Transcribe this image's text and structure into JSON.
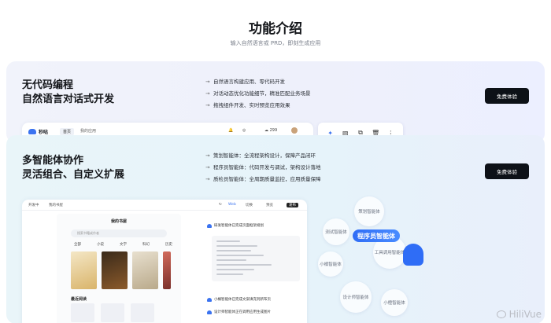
{
  "header": {
    "title": "功能介绍",
    "subtitle": "输入自然语言或 PRD，即刻生成应用"
  },
  "feature1": {
    "title_line1": "无代码编程",
    "title_line2": "自然语言对话式开发",
    "bullets": [
      "自然语言构建应用、零代码开发",
      "对话动态优化功能细节，精准匹配业务场景",
      "拖拽组件开发、实时预览应用效果"
    ],
    "cta": "免费体验",
    "preview": {
      "logo": "秒哒",
      "tab_home": "首页",
      "tab_apps": "我的应用",
      "credits": "299"
    }
  },
  "feature2": {
    "title_line1": "多智能体协作",
    "title_line2": "灵活组合、自定义扩展",
    "bullets": [
      "策划智能体：全流程架构设计，保障产品闭环",
      "程序员智能体：代码开发与调试，架构设计落地",
      "质检员智能体：全周期质量监控，应用质量保障"
    ],
    "cta": "免费体验",
    "app": {
      "tab1": "开发中",
      "tab2": "我的书屋",
      "badge1": "Web",
      "badge2": "切换",
      "preview": "预览",
      "publish": "发布",
      "phone_title": "我的书屋",
      "search_placeholder": "搜索书籍或作者",
      "categories": [
        "全部",
        "小说",
        "文学",
        "科幻",
        "历史"
      ],
      "recent": "最近阅读",
      "msg1": "研发智能体已完成页面框架规划",
      "msg2": "小橘智能体已完成文案填充到新布页",
      "msg3": "设计师智能体正在调用应用生成图片"
    },
    "agents": {
      "main": "程序员智能体",
      "planner": "策划智能体",
      "tester": "测试智能体",
      "pm": "小橘智能体",
      "designer": "设计师智能体",
      "other": "小橙智能体",
      "inspector": "工具调用智能体"
    }
  },
  "watermark": "HiliVue",
  "colors": {
    "accent": "#2f6df6",
    "cta_bg": "#0d1117"
  }
}
